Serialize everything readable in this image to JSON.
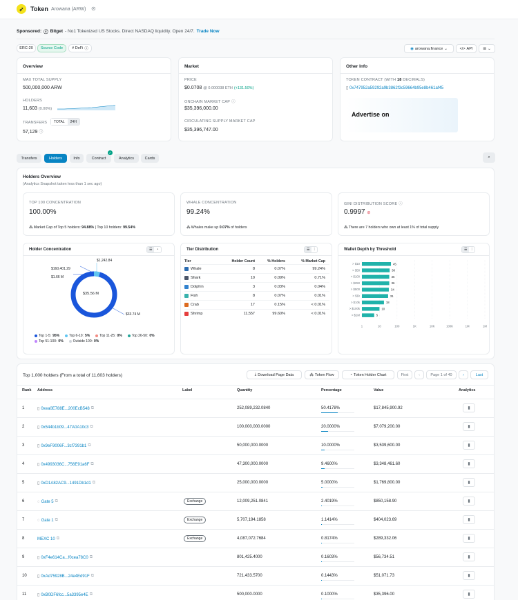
{
  "header": {
    "label": "Token",
    "name": "Arowana (ARW)",
    "sponsored_prefix": "Sponsored:",
    "sponsor_name": "Bitget",
    "sponsor_text": "- No1 Tokenized US Stocks. Direct NASDAQ liquidity. Open 24/7.",
    "sponsor_cta": "Trade Now"
  },
  "tags": [
    "ERC-20",
    "Source Code",
    "# DeFi"
  ],
  "site_button": "arowana.finance",
  "api_button": "API",
  "overview": {
    "title": "Overview",
    "max_supply_label": "MAX TOTAL SUPPLY",
    "max_supply": "500,000,000 ARW",
    "holders_label": "HOLDERS",
    "holders": "11,603",
    "holders_change": "(0.00%)",
    "transfers_label": "TRANSFERS",
    "transfers_toggle": [
      "TOTAL",
      "24H"
    ],
    "transfers": "57,129"
  },
  "market": {
    "title": "Market",
    "price_label": "PRICE",
    "price": "$0.0708",
    "price_eth": "@ 0.000038 ETH",
    "price_change": "(+131.50%)",
    "onchain_cap_label": "ONCHAIN MARKET CAP",
    "onchain_cap": "$35,396,000.00",
    "circ_cap_label": "CIRCULATING SUPPLY MARKET CAP",
    "circ_cap": "$35,396,747.00"
  },
  "other": {
    "title": "Other Info",
    "contract_label_pre": "TOKEN CONTRACT (WITH ",
    "contract_decimals": "18",
    "contract_label_post": " DECIMALS)",
    "contract": "0x747952a59292a9b3862f3c59664b95e8b461af45",
    "advertise": "Advertise on"
  },
  "tabs": [
    "Transfers",
    "Holders",
    "Info",
    "Contract",
    "Analytics",
    "Cards"
  ],
  "holders_overview": {
    "title": "Holders Overview",
    "subtitle": "(Analytics Snapshot taken less than 1 sec ago)",
    "top100_label": "TOP 100 CONCENTRATION",
    "top100": "100.00%",
    "top100_note_pre": "Market Cap of Top 5 holders: ",
    "top5": "94.88%",
    "top100_note_mid": " | Top 10 holders: ",
    "top10": "99.54%",
    "whale_label": "WHALE CONCENTRATION",
    "whale": "99.24%",
    "whale_note_pre": "Whales make up ",
    "whale_pct": "0.07%",
    "whale_note_post": " of holders",
    "gini_label": "GINI DISTRIBUTION SCORE",
    "gini": "0.9997",
    "gini_note": "There are 7 holders who own at least 1% of total supply"
  },
  "concentration": {
    "title": "Holder Concentration",
    "center": "$35.56 M",
    "callouts": [
      "$1,242.84",
      "$160,401.29",
      "$1.66 M",
      "$33.74 M"
    ],
    "legend": [
      {
        "label": "Top 1-5:",
        "value": "95%",
        "color": "#1a56db"
      },
      {
        "label": "Top 6-10:",
        "value": "5%",
        "color": "#60c5f1"
      },
      {
        "label": "Top 11-25:",
        "value": "0%",
        "color": "#f28b82"
      },
      {
        "label": "Top 26-50:",
        "value": "0%",
        "color": "#26a69a"
      },
      {
        "label": "Top 51-100:",
        "value": "0%",
        "color": "#c084fc"
      },
      {
        "label": "Outside 100:",
        "value": "0%",
        "color": "#d1d5db"
      }
    ]
  },
  "tiers": {
    "title": "Tier Distribution",
    "headers": [
      "Tier",
      "Holder Count",
      "% Holders",
      "% Market Cap"
    ],
    "rows": [
      {
        "name": "Whale",
        "count": "8",
        "holders": "0.07%",
        "cap": "99.24%",
        "icon": "whale-icon"
      },
      {
        "name": "Shark",
        "count": "10",
        "holders": "0.09%",
        "cap": "0.71%",
        "icon": "shark-icon"
      },
      {
        "name": "Dolphin",
        "count": "3",
        "holders": "0.03%",
        "cap": "0.04%",
        "icon": "dolphin-icon"
      },
      {
        "name": "Fish",
        "count": "8",
        "holders": "0.07%",
        "cap": "0.01%",
        "icon": "fish-icon"
      },
      {
        "name": "Crab",
        "count": "17",
        "holders": "0.15%",
        "cap": "< 0.01%",
        "icon": "crab-icon"
      },
      {
        "name": "Shrimp",
        "count": "11,557",
        "holders": "99.60%",
        "cap": "< 0.01%",
        "icon": "shrimp-icon"
      }
    ]
  },
  "chart_data": {
    "type": "bar",
    "title": "Wallet Depth by Threshold",
    "categories": [
      "> $10",
      "> $50",
      "> $100",
      "> $250",
      "> $500",
      "> $1k",
      "> $10k",
      "> $100k",
      "> $1M"
    ],
    "values": [
      45,
      38,
      36,
      36,
      34,
      31,
      18,
      10,
      5
    ],
    "xticks": [
      "1",
      "10",
      "100",
      "1K",
      "10K",
      "100K",
      "1M",
      "1M"
    ],
    "xscale": "log",
    "xlim": [
      1,
      10000000
    ],
    "color": "#20b2aa"
  },
  "holders_table": {
    "title": "Top 1,000 holders (From a total of 11,603 holders)",
    "download": "Download Page Data",
    "flow": "Token Flow",
    "chart": "Token Holder Chart",
    "first": "First",
    "page": "Page 1 of 40",
    "last": "Last",
    "headers": [
      "Rank",
      "Address",
      "Label",
      "Quantity",
      "Percentage",
      "Value",
      "Analytics"
    ],
    "rows": [
      {
        "rank": "1",
        "address": "0xea0E788E...200EcB548",
        "label": "",
        "qty": "252,089,232.0840",
        "pct": "50.4178%",
        "pct_num": 50.42,
        "value": "$17,845,900.92",
        "kind": "contract"
      },
      {
        "rank": "2",
        "address": "0x544b1b09...47A0A10c3",
        "label": "",
        "qty": "100,000,000.0000",
        "pct": "20.0000%",
        "pct_num": 20.0,
        "value": "$7,079,200.00",
        "kind": "contract"
      },
      {
        "rank": "3",
        "address": "0x9eF9006F...3cf7391b1",
        "label": "",
        "qty": "50,000,000.0000",
        "pct": "10.0000%",
        "pct_num": 10.0,
        "value": "$3,539,600.00",
        "kind": "contract"
      },
      {
        "rank": "4",
        "address": "0x4993036C...756E91a6F",
        "label": "",
        "qty": "47,300,000.0000",
        "pct": "9.4600%",
        "pct_num": 9.46,
        "value": "$3,348,461.60",
        "kind": "contract"
      },
      {
        "rank": "5",
        "address": "0xD1A82AC9...1491Db1d1",
        "label": "",
        "qty": "25,000,000.0000",
        "pct": "5.0000%",
        "pct_num": 5.0,
        "value": "$1,769,800.00",
        "kind": "contract"
      },
      {
        "rank": "6",
        "address": "Gate 5",
        "label": "Exchange",
        "qty": "12,009,251.0841",
        "pct": "2.4019%",
        "pct_num": 2.4,
        "value": "$850,158.90",
        "kind": "exchange"
      },
      {
        "rank": "7",
        "address": "Gate 1",
        "label": "Exchange",
        "qty": "5,707,194.1858",
        "pct": "1.1414%",
        "pct_num": 1.14,
        "value": "$404,023.69",
        "kind": "exchange"
      },
      {
        "rank": "8",
        "address": "MEXC 10",
        "label": "Exchange",
        "qty": "4,087,072.7684",
        "pct": "0.8174%",
        "pct_num": 0.82,
        "value": "$289,332.06",
        "kind": "plain"
      },
      {
        "rank": "9",
        "address": "0xF4e614Ca...f0cea78C0",
        "label": "",
        "qty": "801,425.4000",
        "pct": "0.1603%",
        "pct_num": 0.16,
        "value": "$56,734.51",
        "kind": "contract"
      },
      {
        "rank": "10",
        "address": "0xAd75928B...24e4Ed91F",
        "label": "",
        "qty": "721,433.5700",
        "pct": "0.1443%",
        "pct_num": 0.14,
        "value": "$51,071.73",
        "kind": "contract"
      },
      {
        "rank": "11",
        "address": "0xB0DF6fcc...5a3395e4E",
        "label": "",
        "qty": "500,000.0000",
        "pct": "0.1000%",
        "pct_num": 0.1,
        "value": "$35,396.00",
        "kind": "contract"
      }
    ]
  }
}
